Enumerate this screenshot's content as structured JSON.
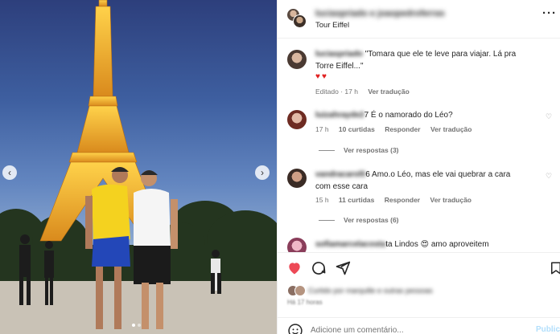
{
  "photo": {
    "prev_glyph": "‹",
    "next_glyph": "›",
    "dots": 2
  },
  "post": {
    "users_blurred": "luciaspriado e joaopedroferras",
    "location": "Tour Eiffel",
    "more_glyph": "···"
  },
  "comments": [
    {
      "user": "luciaspriado",
      "text": "\"Tomara que ele te leve para viajar. Lá pra Torre Eiffel...\"",
      "hearts": "♥♥",
      "meta": [
        "Editado · 17 h",
        "Ver tradução"
      ]
    },
    {
      "user": "luizahrayde2",
      "text": "7 É o namorado do Léo?",
      "meta": [
        "17 h",
        "10 curtidas",
        "Responder",
        "Ver tradução"
      ],
      "replies": "Ver respostas (3)"
    },
    {
      "user": "vandracarolli",
      "text": "6 Amo.o Léo, mas ele vai quebrar a cara com esse cara",
      "meta": [
        "15 h",
        "11 curtidas",
        "Responder",
        "Ver tradução"
      ],
      "replies": "Ver respostas (6)"
    },
    {
      "user": "sofiamarcelacosta",
      "text": "ta Lindos",
      "emoji": "😍",
      "text_after": "amo aproveitem"
    }
  ],
  "likes": {
    "text_blurred": "Curtido por marquille e outras pessoas",
    "date_blurred": "Há 17 horas"
  },
  "add_comment": {
    "placeholder": "Adicione um comentário...",
    "publish_label": "Publicar"
  },
  "colors": {
    "heart_red": "#ed4956",
    "link_blue": "#0095f6",
    "muted": "#737373"
  }
}
